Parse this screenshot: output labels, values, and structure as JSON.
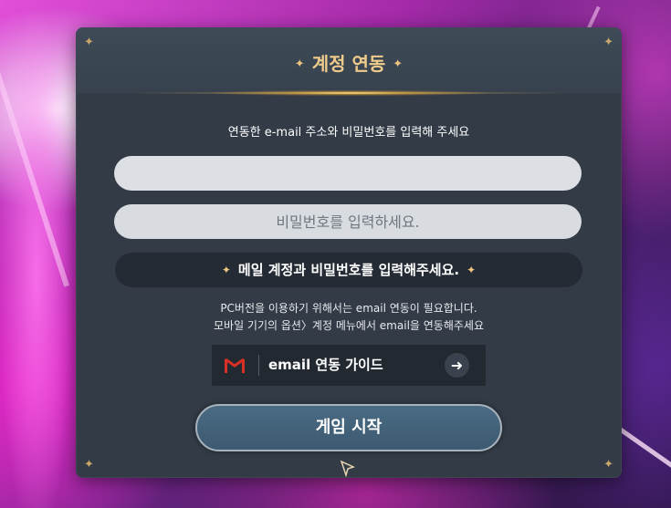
{
  "dialog": {
    "title": "계정 연동",
    "title_ornament": "✦",
    "instruction": "연동한 e-mail 주소와 비밀번호를 입력해 주세요",
    "email_field": {
      "value": "",
      "placeholder": ""
    },
    "password_field": {
      "value": "",
      "placeholder": "비밀번호를 입력하세요."
    },
    "warning": {
      "text": "메일 계정과 비밀번호를 입력해주세요.",
      "ornament": "✦"
    },
    "notice_lines": [
      "PC버전을 이용하기 위해서는 email 연동이 필요합니다.",
      "모바일 기기의 옵션〉계정 메뉴에서 email을 연동해주세요"
    ],
    "guide_button": {
      "label": "email 연동 가이드",
      "icon": "gmail-icon",
      "arrow": "➜"
    },
    "start_button": {
      "label": "게임 시작"
    },
    "corner_ornament": "✦"
  },
  "colors": {
    "panel_bg": "#323b46",
    "title": "#f0cc8c",
    "button": "#4a6b84",
    "field": "#d8dbe0",
    "gmail_red": "#d93025"
  }
}
